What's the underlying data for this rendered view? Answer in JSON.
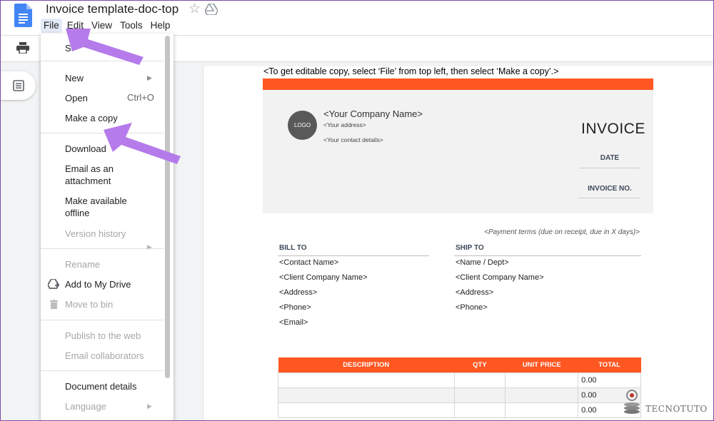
{
  "app": {
    "doc_title": "Invoice template-doc-top",
    "menubar": [
      "File",
      "Edit",
      "View",
      "Tools",
      "Help"
    ],
    "active_menu": "File"
  },
  "file_menu": {
    "items": [
      {
        "label": "Share",
        "visible_label": "S",
        "enabled": true
      },
      {
        "label": "New",
        "enabled": true,
        "submenu": true
      },
      {
        "label": "Open",
        "shortcut": "Ctrl+O",
        "enabled": true
      },
      {
        "label": "Make a copy",
        "enabled": true
      },
      {
        "label": "Download",
        "enabled": true
      },
      {
        "label": "Email as an attachment",
        "line1": "Email as an",
        "line2": "attachment",
        "enabled": true
      },
      {
        "label": "Make available offline",
        "line1": "Make available",
        "line2": "offline",
        "enabled": true
      },
      {
        "label": "Version history",
        "enabled": false,
        "submenu": true
      },
      {
        "label": "Rename",
        "enabled": false
      },
      {
        "label": "Add to My Drive",
        "enabled": true,
        "icon": "drive-add-icon"
      },
      {
        "label": "Move to bin",
        "enabled": false,
        "icon": "trash-icon"
      },
      {
        "label": "Publish to the web",
        "enabled": false
      },
      {
        "label": "Email collaborators",
        "enabled": false
      },
      {
        "label": "Document details",
        "enabled": true
      },
      {
        "label": "Language",
        "enabled": false,
        "submenu": true
      }
    ]
  },
  "document": {
    "instruction": "<To get editable copy, select ‘File’ from top left, then select ‘Make a copy’.>",
    "logo_text": "LOGO",
    "company_name": "<Your Company Name>",
    "company_address": "<Your address>",
    "company_contact": "<Your contact details>",
    "invoice_heading": "INVOICE",
    "date_label": "DATE",
    "invoice_no_label": "INVOICE NO.",
    "payment_terms": "<Payment terms (due on receipt, due in X days)>",
    "bill_to": {
      "heading": "BILL TO",
      "lines": [
        "<Contact Name>",
        "<Client Company Name>",
        "<Address>",
        "<Phone>",
        "<Email>"
      ]
    },
    "ship_to": {
      "heading": "SHIP TO",
      "lines": [
        "<Name / Dept>",
        "<Client Company Name>",
        "<Address>",
        "<Phone>"
      ]
    },
    "table": {
      "headers": [
        "DESCRIPTION",
        "QTY",
        "UNIT PRICE",
        "TOTAL"
      ],
      "totals": [
        "0.00",
        "0.00",
        "0.00"
      ]
    }
  },
  "icons": [
    "docs-logo-icon",
    "star-icon",
    "drive-icon",
    "print-icon",
    "outline-icon",
    "drive-add-icon",
    "trash-icon",
    "submenu-arrow-icon"
  ],
  "colors": {
    "accent_orange": "#ff5722",
    "annotation_purple": "#b57bea",
    "docs_blue": "#4285f4"
  },
  "watermark": "TECNOTUTO"
}
